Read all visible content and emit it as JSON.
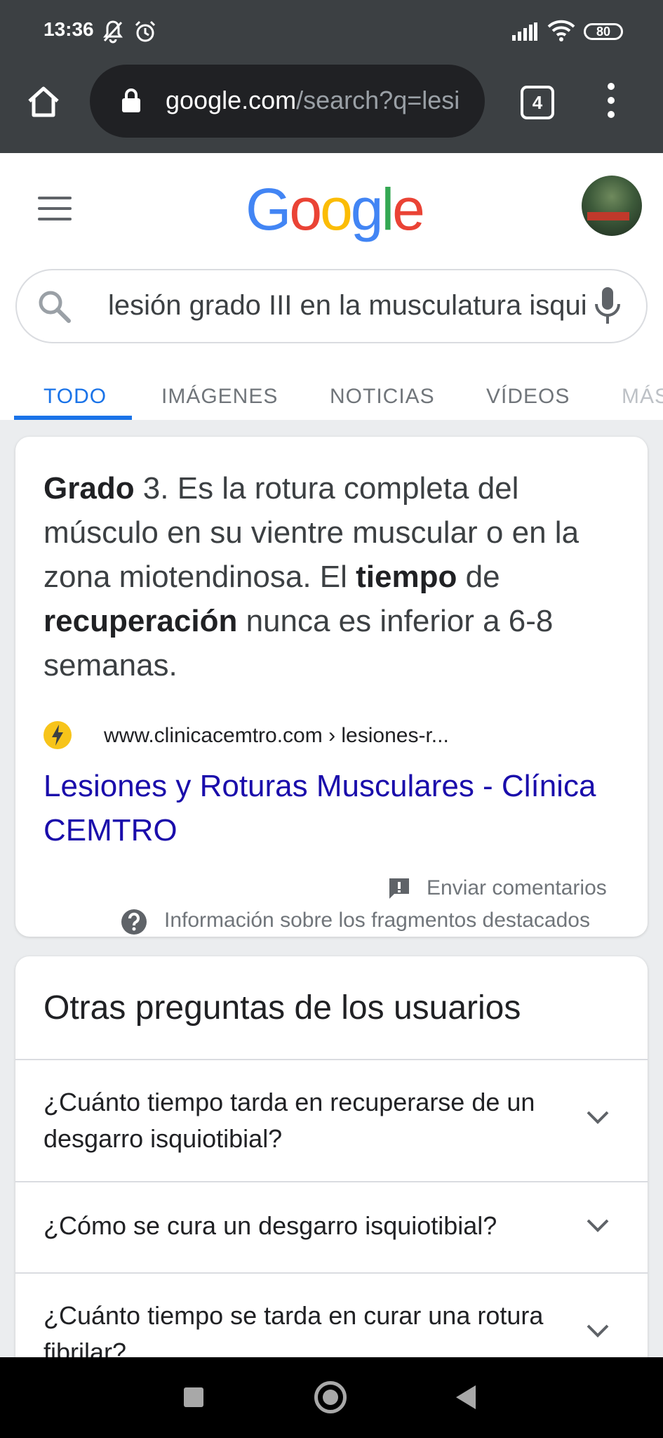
{
  "status_bar": {
    "time": "13:36",
    "battery": "80",
    "icons": [
      "bell-off-icon",
      "alarm-icon",
      "signal-icon",
      "wifi-icon",
      "battery-icon"
    ]
  },
  "browser": {
    "url_host": "google.com",
    "url_rest": "/search?q=lesic",
    "tab_count": "4"
  },
  "google": {
    "logo": [
      "G",
      "o",
      "o",
      "g",
      "l",
      "e"
    ],
    "logo_colors": [
      "#4285f4",
      "#ea4335",
      "#fbbc05",
      "#4285f4",
      "#34a853",
      "#ea4335"
    ],
    "search_query": "lesión grado III en la musculatura isquiotibial",
    "tabs": [
      "TODO",
      "IMÁGENES",
      "NOTICIAS",
      "VÍDEOS",
      "MÁS"
    ]
  },
  "snippet": {
    "t1": "Grado",
    "t2": " 3. Es la rotura completa del músculo en su vientre muscular o en la zona miotendinosa. El ",
    "t3": "tiempo",
    "t4": " de ",
    "t5": "recuperación",
    "t6": " nunca es inferior a 6-8 semanas.",
    "source_url": "www.clinicacemtro.com › lesiones-r...",
    "result_title": "Lesiones y Roturas Musculares - Clínica CEMTRO",
    "feedback": "Enviar comentarios",
    "info": "Información sobre los fragmentos destacados"
  },
  "paa": {
    "title": "Otras preguntas de los usuarios",
    "questions": [
      "¿Cuánto tiempo tarda en recuperarse de un desgarro isquiotibial?",
      "¿Cómo se cura un desgarro isquiotibial?",
      "¿Cuánto tiempo se tarda en curar una rotura fibrilar?"
    ]
  },
  "colors": {
    "chrome": "#3c4043",
    "link": "#1a0dab",
    "accent": "#1a73e8"
  }
}
